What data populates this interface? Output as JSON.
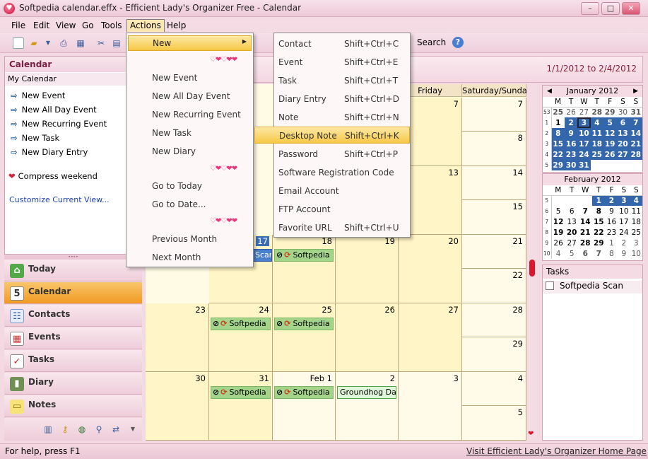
{
  "window": {
    "title": "Softpedia calendar.effx - Efficient Lady's Organizer Free - Calendar",
    "min_label": "–",
    "max_label": "□",
    "close_label": "✕"
  },
  "menubar": [
    "File",
    "Edit",
    "View",
    "Go",
    "Tools",
    "Actions",
    "Help"
  ],
  "toolbar": {
    "search_label": "Search",
    "help_glyph": "?"
  },
  "left_panel": {
    "header": "Calendar",
    "subheader": "My Calendar",
    "items": [
      "New Event",
      "New All Day Event",
      "New Recurring Event",
      "New Task",
      "New Diary Entry"
    ],
    "compress": "Compress weekend",
    "customize": "Customize Current View..."
  },
  "nav": [
    "Today",
    "Calendar",
    "Contacts",
    "Events",
    "Tasks",
    "Diary",
    "Notes"
  ],
  "calendar": {
    "date_range": "1/1/2012 to 2/4/2012",
    "day_headers": [
      "Friday",
      "Saturday/Sunday"
    ],
    "cells": {
      "r1_fri": "7",
      "r1_sat": "7",
      "r1_sun": "8",
      "r2_fri": "13",
      "r2_sat": "14",
      "r2_sun": "15",
      "r3_tue": "17",
      "r3_wed": "18",
      "r3_thu": "19",
      "r3_fri": "20",
      "r3_sat": "21",
      "r3_sun": "22",
      "r4_mon": "23",
      "r4_tue": "24",
      "r4_wed": "25",
      "r4_thu": "26",
      "r4_fri": "27",
      "r4_sat": "28",
      "r4_sun": "29",
      "r5_mon": "30",
      "r5_tue": "31",
      "r5_wed": "Feb 1",
      "r5_thu": "2",
      "r5_fri": "3",
      "r5_sat": "4",
      "r5_sun": "5"
    },
    "event_softpedia": "Softpedia",
    "event_scan": "Scan",
    "event_groundhog": "Groundhog Day"
  },
  "mini_jan": {
    "title": "January 2012",
    "dow": [
      "M",
      "T",
      "W",
      "T",
      "F",
      "S",
      "S"
    ],
    "weeks": [
      {
        "wn": "53",
        "days": [
          "25",
          "26",
          "27",
          "28",
          "29",
          "30",
          "31"
        ]
      },
      {
        "wn": "1",
        "days": [
          "1",
          "2",
          "3",
          "4",
          "5",
          "6",
          "7"
        ]
      },
      {
        "wn": "2",
        "days": [
          "8",
          "9",
          "10",
          "11",
          "12",
          "13",
          "14"
        ]
      },
      {
        "wn": "3",
        "days": [
          "15",
          "16",
          "17",
          "18",
          "19",
          "20",
          "21"
        ]
      },
      {
        "wn": "4",
        "days": [
          "22",
          "23",
          "24",
          "25",
          "26",
          "27",
          "28"
        ]
      },
      {
        "wn": "5",
        "days": [
          "29",
          "30",
          "31",
          "",
          "",
          "",
          ""
        ]
      }
    ]
  },
  "mini_feb": {
    "title": "February 2012",
    "weeks": [
      {
        "wn": "5",
        "days": [
          "",
          "",
          "",
          "1",
          "2",
          "3",
          "4"
        ]
      },
      {
        "wn": "6",
        "days": [
          "5",
          "6",
          "7",
          "8",
          "9",
          "10",
          "11"
        ]
      },
      {
        "wn": "7",
        "days": [
          "12",
          "13",
          "14",
          "15",
          "16",
          "17",
          "18"
        ]
      },
      {
        "wn": "8",
        "days": [
          "19",
          "20",
          "21",
          "22",
          "23",
          "24",
          "25"
        ]
      },
      {
        "wn": "9",
        "days": [
          "26",
          "27",
          "28",
          "29",
          "1",
          "2",
          "3"
        ]
      },
      {
        "wn": "10",
        "days": [
          "4",
          "5",
          "6",
          "7",
          "8",
          "9",
          "10"
        ]
      }
    ]
  },
  "tasks": {
    "header": "Tasks",
    "item": "Softpedia Scan"
  },
  "actions_menu": {
    "new": "New",
    "items": [
      "New Event",
      "New All Day Event",
      "New Recurring Event",
      "New Task",
      "New Diary",
      "Go to Today",
      "Go to Date...",
      "Previous Month",
      "Next Month"
    ]
  },
  "new_menu": [
    {
      "label": "Contact",
      "shortcut": "Shift+Ctrl+C"
    },
    {
      "label": "Event",
      "shortcut": "Shift+Ctrl+E"
    },
    {
      "label": "Task",
      "shortcut": "Shift+Ctrl+T"
    },
    {
      "label": "Diary Entry",
      "shortcut": "Shift+Ctrl+D"
    },
    {
      "label": "Note",
      "shortcut": "Shift+Ctrl+N"
    },
    {
      "label": "Desktop Note",
      "shortcut": "Shift+Ctrl+K"
    },
    {
      "label": "Password",
      "shortcut": "Shift+Ctrl+P"
    },
    {
      "label": "Software Registration Code",
      "shortcut": ""
    },
    {
      "label": "Email Account",
      "shortcut": ""
    },
    {
      "label": "FTP Account",
      "shortcut": ""
    },
    {
      "label": "Favorite URL",
      "shortcut": "Shift+Ctrl+U"
    }
  ],
  "status": {
    "text": "For help, press F1",
    "link": "Visit Efficient Lady's Organizer Home Page"
  }
}
